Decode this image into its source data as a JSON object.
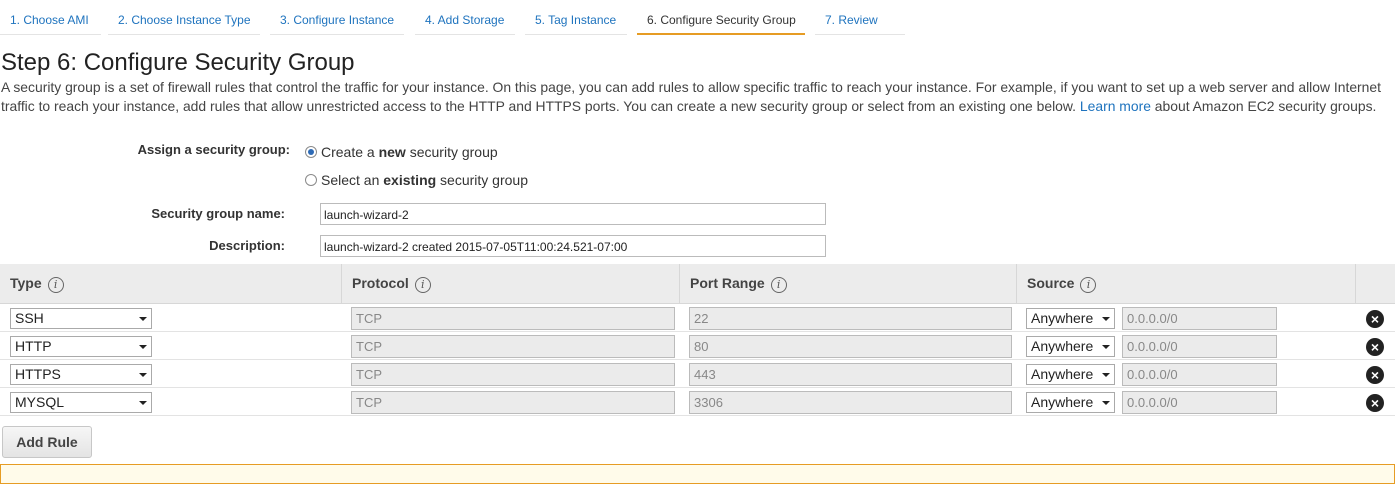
{
  "tabs": [
    {
      "label": "1. Choose AMI"
    },
    {
      "label": "2. Choose Instance Type"
    },
    {
      "label": "3. Configure Instance"
    },
    {
      "label": "4. Add Storage"
    },
    {
      "label": "5. Tag Instance"
    },
    {
      "label": "6. Configure Security Group"
    },
    {
      "label": "7. Review"
    }
  ],
  "page": {
    "title": "Step 6: Configure Security Group",
    "desc_before": "A security group is a set of firewall rules that control the traffic for your instance. On this page, you can add rules to allow specific traffic to reach your instance. For example, if you want to set up a web server and allow Internet traffic to reach your instance, add rules that allow unrestricted access to the HTTP and HTTPS ports. You can create a new security group or select from an existing one below. ",
    "desc_link": "Learn more",
    "desc_after": " about Amazon EC2 security groups."
  },
  "form": {
    "assign_label": "Assign a security group:",
    "option_new_pre": "Create a ",
    "option_new_bold": "new",
    "option_new_post": " security group",
    "option_existing_pre": "Select an ",
    "option_existing_bold": "existing",
    "option_existing_post": " security group",
    "name_label": "Security group name:",
    "name_value": "launch-wizard-2",
    "desc_label": "Description:",
    "desc_value": "launch-wizard-2 created 2015-07-05T11:00:24.521-07:00"
  },
  "table": {
    "headers": {
      "type": "Type",
      "protocol": "Protocol",
      "port_range": "Port Range",
      "source": "Source"
    },
    "info_glyph": "i",
    "rows": [
      {
        "type": "SSH",
        "protocol": "TCP",
        "port": "22",
        "source": "Anywhere",
        "cidr": "0.0.0.0/0"
      },
      {
        "type": "HTTP",
        "protocol": "TCP",
        "port": "80",
        "source": "Anywhere",
        "cidr": "0.0.0.0/0"
      },
      {
        "type": "HTTPS",
        "protocol": "TCP",
        "port": "443",
        "source": "Anywhere",
        "cidr": "0.0.0.0/0"
      },
      {
        "type": "MYSQL",
        "protocol": "TCP",
        "port": "3306",
        "source": "Anywhere",
        "cidr": "0.0.0.0/0"
      }
    ],
    "remove_glyph": "×"
  },
  "actions": {
    "add_rule": "Add Rule"
  },
  "colors": {
    "link": "#1e73be",
    "active_tab": "#e69c24",
    "header_bg": "#ececec"
  }
}
